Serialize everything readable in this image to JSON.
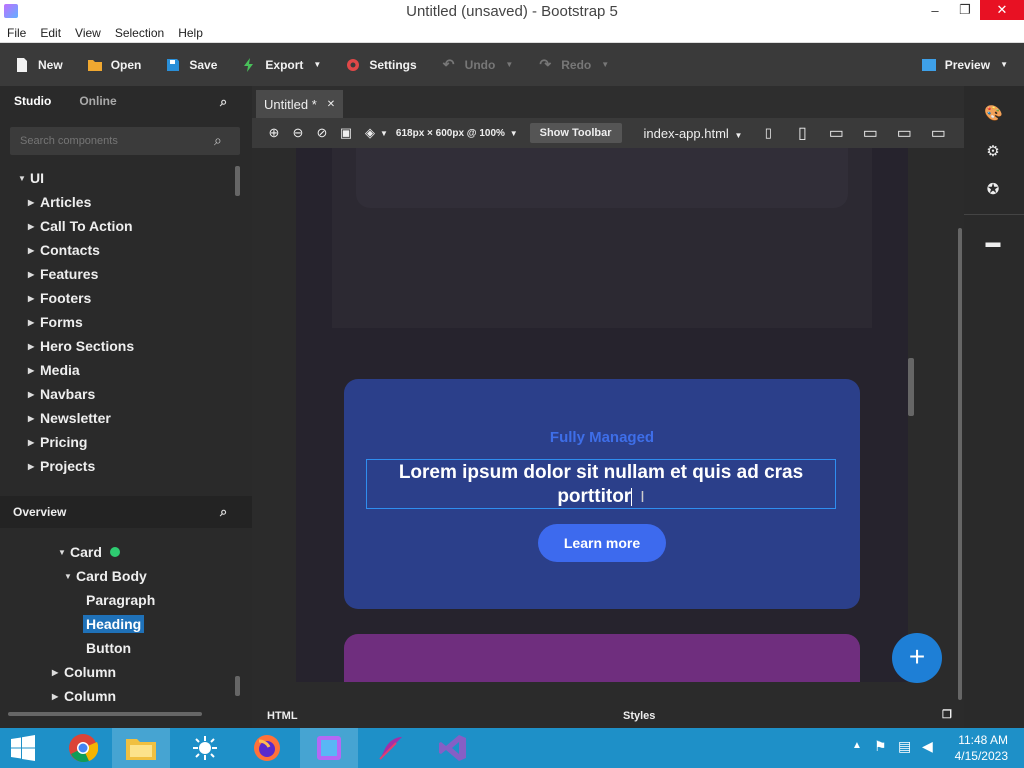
{
  "window": {
    "title": "Untitled (unsaved) - Bootstrap 5",
    "minimize": "–",
    "maximize": "❐",
    "close": "✕"
  },
  "menu": [
    "File",
    "Edit",
    "View",
    "Selection",
    "Help"
  ],
  "toolbar": {
    "new": "New",
    "open": "Open",
    "save": "Save",
    "export": "Export",
    "settings": "Settings",
    "undo": "Undo",
    "redo": "Redo",
    "preview": "Preview"
  },
  "left_panel": {
    "tabs": [
      "Studio",
      "Online"
    ],
    "search_placeholder": "Search components",
    "root": "UI",
    "categories": [
      "Articles",
      "Call To Action",
      "Contacts",
      "Features",
      "Footers",
      "Forms",
      "Hero Sections",
      "Media",
      "Navbars",
      "Newsletter",
      "Pricing",
      "Projects"
    ]
  },
  "overview": {
    "title": "Overview",
    "items": [
      "Card",
      "Card Body",
      "Paragraph",
      "Heading",
      "Button",
      "Column",
      "Column"
    ]
  },
  "editor": {
    "tab_label": "Untitled *",
    "viewport": "618px × 600px @ 100%",
    "show_toolbar": "Show Toolbar",
    "file": "index-app.html"
  },
  "canvas": {
    "eyebrow": "Fully Managed",
    "heading_line1": "Lorem ipsum dolor sit nullam et quis ad cras",
    "heading_line2": "porttitor",
    "button": "Learn more"
  },
  "bottom_tabs": {
    "html": "HTML",
    "styles": "Styles"
  },
  "taskbar": {
    "time": "11:48 AM",
    "date": "4/15/2023"
  }
}
